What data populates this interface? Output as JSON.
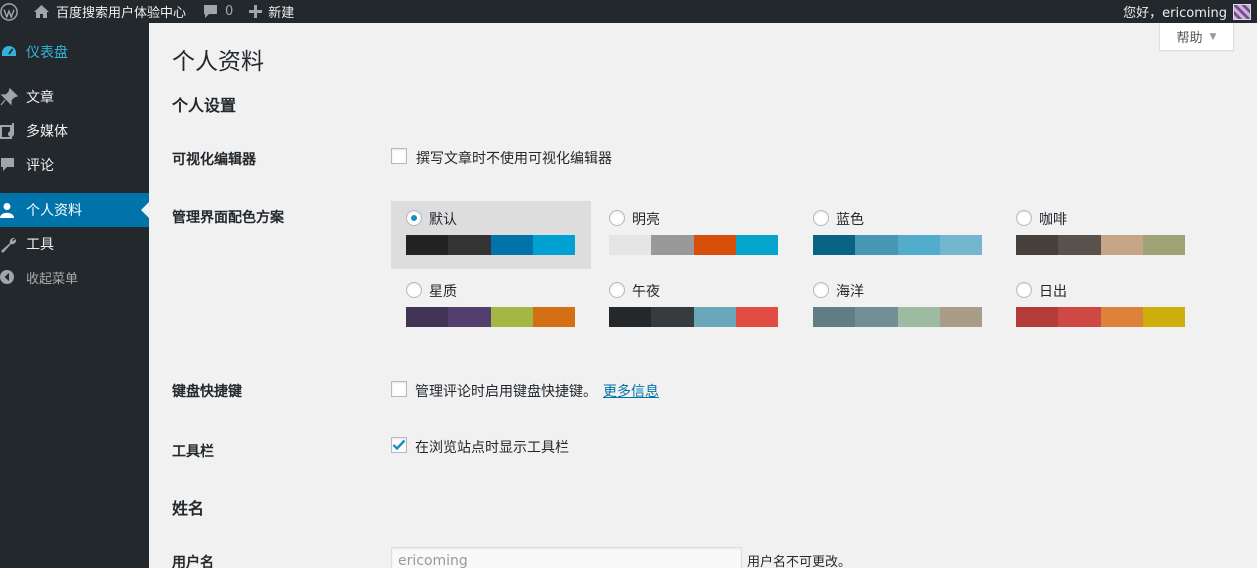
{
  "adminbar": {
    "site_name": "百度搜索用户体验中心",
    "comment_count": "0",
    "new_label": "新建",
    "greeting": "您好，ericoming"
  },
  "sidebar": {
    "items": [
      {
        "label": "仪表盘",
        "icon": "dashboard-icon"
      },
      {
        "label": "文章",
        "icon": "pin-icon"
      },
      {
        "label": "多媒体",
        "icon": "media-icon"
      },
      {
        "label": "评论",
        "icon": "comment-icon"
      },
      {
        "label": "个人资料",
        "icon": "user-icon"
      },
      {
        "label": "工具",
        "icon": "wrench-icon"
      },
      {
        "label": "收起菜单",
        "icon": "collapse-arrow-icon"
      }
    ],
    "active_color": "#0073aa"
  },
  "help": {
    "label": "帮助"
  },
  "page": {
    "title": "个人资料",
    "section_personal": "个人设置",
    "section_name": "姓名"
  },
  "visual_editor": {
    "label": "可视化编辑器",
    "checkbox_text": "撰写文章时不使用可视化编辑器",
    "checked": false
  },
  "color_scheme": {
    "label": "管理界面配色方案",
    "selected": "默认",
    "schemes": [
      {
        "name": "默认",
        "colors": [
          "#222222",
          "#333333",
          "#0073aa",
          "#00a0d2"
        ]
      },
      {
        "name": "明亮",
        "colors": [
          "#e5e5e5",
          "#999999",
          "#d64e07",
          "#04a4cc"
        ]
      },
      {
        "name": "蓝色",
        "colors": [
          "#096484",
          "#4796b3",
          "#52accc",
          "#74b6ce"
        ]
      },
      {
        "name": "咖啡",
        "colors": [
          "#46403c",
          "#59524c",
          "#c7a589",
          "#9ea476"
        ]
      },
      {
        "name": "星质",
        "colors": [
          "#413256",
          "#523f6d",
          "#a3b745",
          "#d46f15"
        ]
      },
      {
        "name": "午夜",
        "colors": [
          "#25282b",
          "#363b3f",
          "#69a8bb",
          "#e14d43"
        ]
      },
      {
        "name": "海洋",
        "colors": [
          "#627c83",
          "#738e96",
          "#9ebaa0",
          "#aa9d88"
        ]
      },
      {
        "name": "日出",
        "colors": [
          "#b43c38",
          "#cf4944",
          "#dd823b",
          "#ccaf0b"
        ]
      }
    ]
  },
  "keyboard": {
    "label": "键盘快捷键",
    "checkbox_text": "管理评论时启用键盘快捷键。",
    "link_text": "更多信息",
    "checked": false
  },
  "toolbar": {
    "label": "工具栏",
    "checkbox_text": "在浏览站点时显示工具栏",
    "checked": true
  },
  "username": {
    "label": "用户名",
    "value": "ericoming",
    "description": "用户名不可更改。"
  }
}
